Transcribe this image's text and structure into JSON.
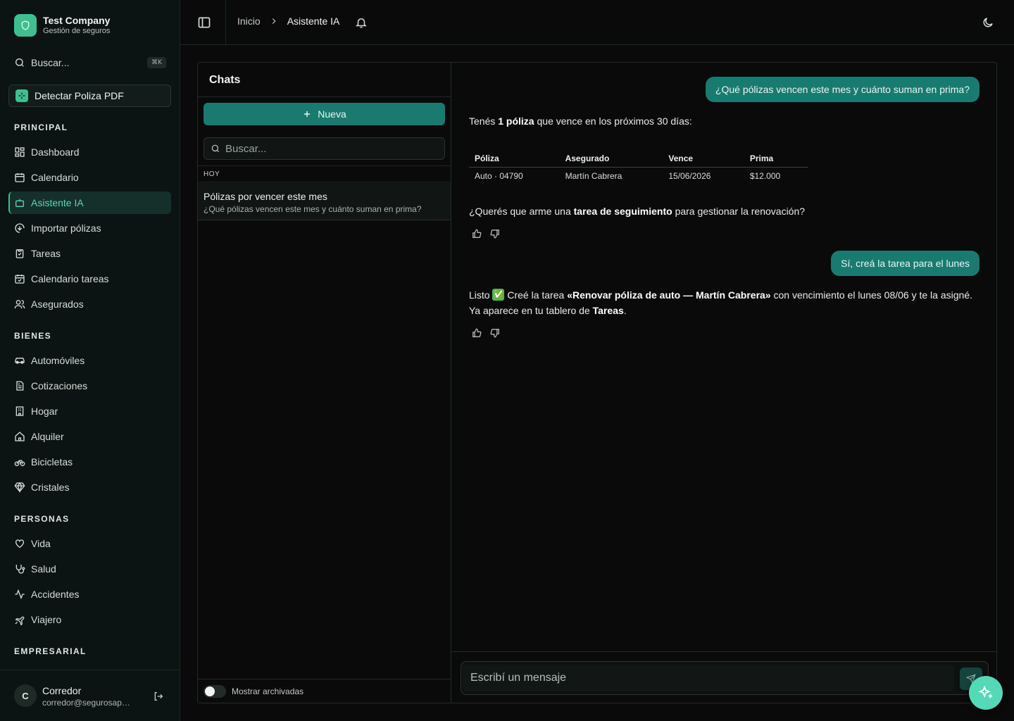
{
  "brand": {
    "name": "Test Company",
    "subtitle": "Gestión de seguros"
  },
  "sidebar": {
    "search_label": "Buscar...",
    "search_shortcut": "⌘K",
    "detect_button": "Detectar Poliza PDF",
    "sections": {
      "principal": "PRINCIPAL",
      "bienes": "BIENES",
      "personas": "PERSONAS",
      "empresarial": "EMPRESARIAL"
    },
    "principal_items": [
      "Dashboard",
      "Calendario",
      "Asistente IA",
      "Importar pólizas",
      "Tareas",
      "Calendario tareas",
      "Asegurados"
    ],
    "bienes_items": [
      "Automóviles",
      "Cotizaciones",
      "Hogar",
      "Alquiler",
      "Bicicletas",
      "Cristales"
    ],
    "personas_items": [
      "Vida",
      "Salud",
      "Accidentes",
      "Viajero"
    ],
    "active_item": "Asistente IA",
    "user": {
      "initial": "C",
      "name": "Corredor",
      "email": "corredor@segurosapp.com"
    }
  },
  "header": {
    "breadcrumb_home": "Inicio",
    "breadcrumb_current": "Asistente IA"
  },
  "chats": {
    "title": "Chats",
    "new_label": "Nueva",
    "search_placeholder": "Buscar...",
    "group_today": "HOY",
    "items": [
      {
        "title": "Pólizas por vencer este mes",
        "preview": "¿Qué pólizas vencen este mes y cuánto suman en prima?"
      }
    ],
    "archive_label": "Mostrar archivadas"
  },
  "conversation": {
    "user_msg_1": "¿Qué pólizas vencen este mes y cuánto suman en prima?",
    "ai_msg_1": {
      "pre": "Tenés ",
      "bold": "1 póliza",
      "post": " que vence en los próximos 30 días:"
    },
    "table": {
      "headers": [
        "Póliza",
        "Asegurado",
        "Vence",
        "Prima"
      ],
      "rows": [
        [
          "Auto · 04790",
          "Martín Cabrera",
          "15/06/2026",
          "$12.000"
        ]
      ]
    },
    "ai_msg_1_followup": {
      "pre": "¿Querés que arme una ",
      "bold": "tarea de seguimiento",
      "post": " para gestionar la renovación?"
    },
    "user_msg_2": "Sí, creá la tarea para el lunes",
    "ai_msg_2": {
      "part1": "Listo ",
      "emoji": "✅",
      "part2": " Creé la tarea ",
      "bold1": "«Renovar póliza de auto — Martín Cabrera»",
      "part3": " con vencimiento el lunes 08/06 y te la asigné.",
      "part4": "Ya aparece en tu tablero de ",
      "bold2": "Tareas",
      "part5": "."
    },
    "composer_placeholder": "Escribí un mensaje"
  },
  "colors": {
    "accent": "#197a70",
    "brand": "#3fbf8f",
    "fab": "#54d9b6"
  }
}
